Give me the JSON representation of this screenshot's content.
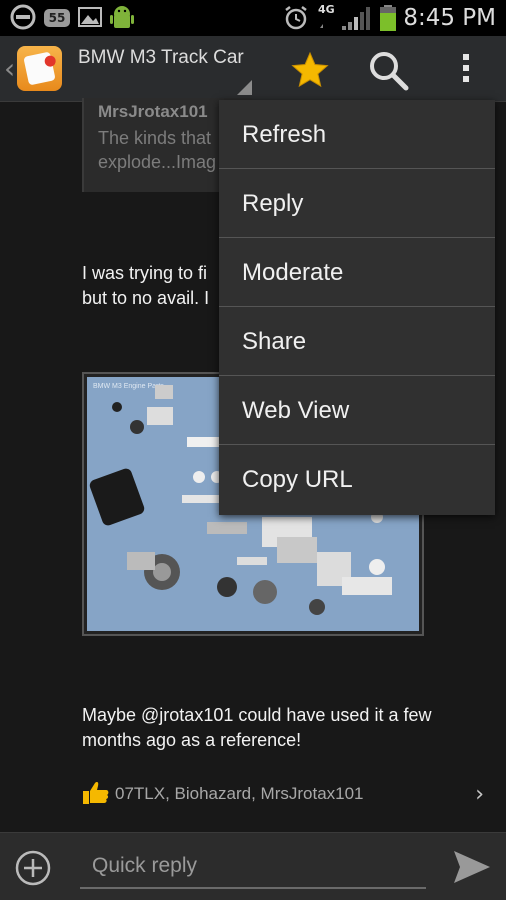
{
  "status_bar": {
    "notification_badge": "55",
    "network": "4G",
    "time": "8:45 PM",
    "icons": [
      "minus-circle-icon",
      "image-icon",
      "android-icon",
      "alarm-icon",
      "signal-icon",
      "battery-icon"
    ]
  },
  "action_bar": {
    "title": "BMW M3 Track Car",
    "icons": [
      "back-chevron-icon",
      "app-icon",
      "star-icon",
      "search-icon",
      "overflow-menu-icon"
    ],
    "accent_color": "#f5b800"
  },
  "thread": {
    "quote": {
      "author": "MrsJrotax101",
      "line1": "The kinds that",
      "line2": "explode...Imag"
    },
    "post1": {
      "line1": "I was trying to fi",
      "line2": "but to no avail. I"
    },
    "picture_caption": "BMW M3 Engine Parts",
    "post2": "Maybe @jrotax101 could have used it a few months ago as a reference!",
    "thanks": "07TLX, Biohazard, MrsJrotax101"
  },
  "menu": {
    "items": [
      "Refresh",
      "Reply",
      "Moderate",
      "Share",
      "Web View",
      "Copy URL"
    ]
  },
  "reply_bar": {
    "placeholder": "Quick reply"
  }
}
